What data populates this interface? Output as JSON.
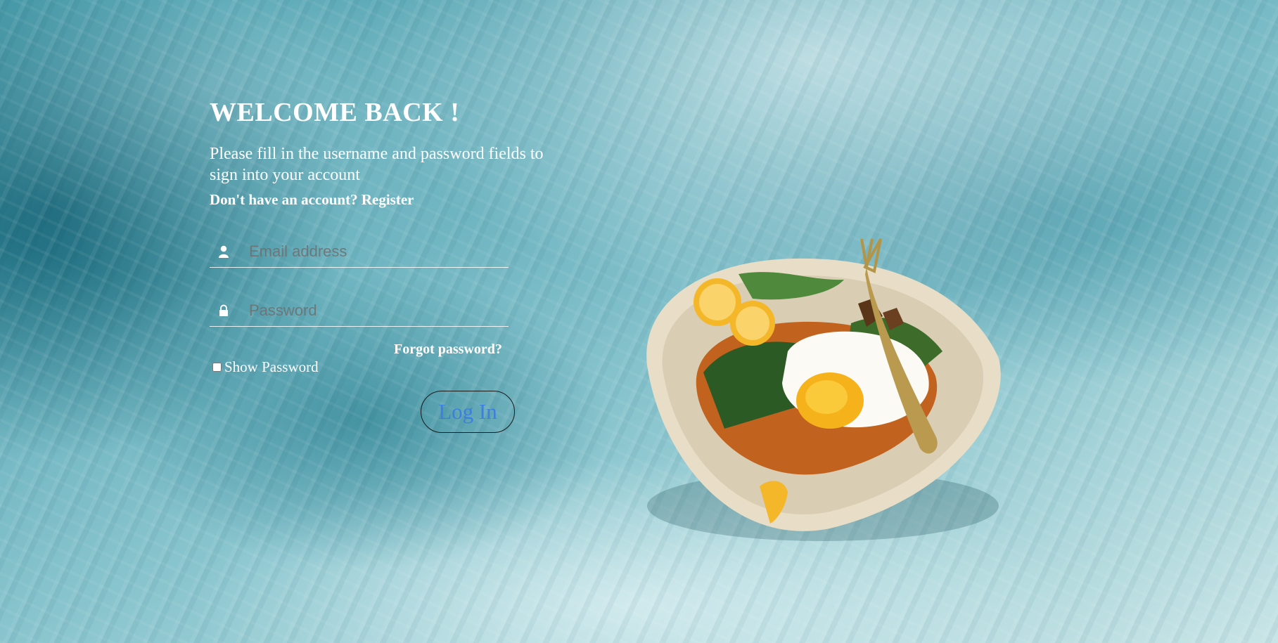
{
  "login": {
    "title": "WELCOME BACK !",
    "subtitle": "Please fill in the username and password fields to sign into your account",
    "register_prompt": "Don't have an account?",
    "register_link": "Register",
    "email_placeholder": "Email address",
    "password_placeholder": "Password",
    "forgot_password": "Forgot password?",
    "show_password": "Show Password",
    "login_button": "Log In"
  },
  "icons": {
    "email": "user-icon",
    "password": "lock-icon"
  },
  "colors": {
    "text": "#ffffff",
    "button_text": "#3b7fe0",
    "button_border": "#1a1a1a",
    "background": "#6fb5c1"
  }
}
